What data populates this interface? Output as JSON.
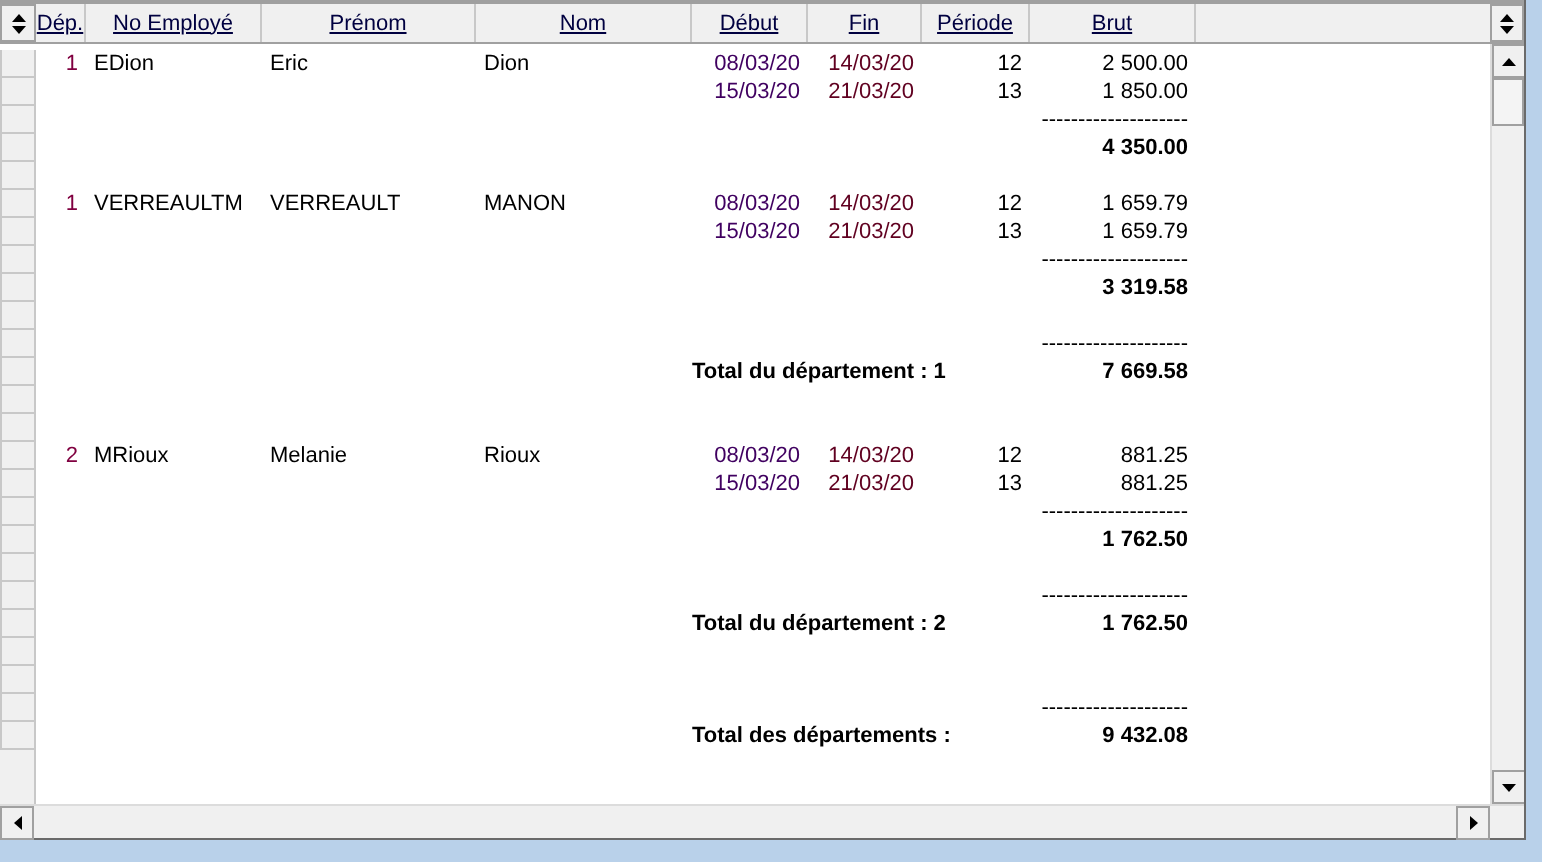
{
  "columns": [
    "Dép.",
    "No Employé",
    "Prénom",
    "Nom",
    "Début",
    "Fin",
    "Période",
    "Brut"
  ],
  "lines": [
    {
      "kind": "employee",
      "dep": "1",
      "employee_no": "EDion",
      "first_name": "Eric",
      "last_name": "Dion",
      "start": "08/03/20",
      "end": "14/03/20",
      "period": "12",
      "gross": "2 500.00"
    },
    {
      "kind": "period",
      "start": "15/03/20",
      "end": "21/03/20",
      "period": "13",
      "gross": "1 850.00"
    },
    {
      "kind": "dashes",
      "gross": "--------------------"
    },
    {
      "kind": "subtotal",
      "gross": "4 350.00"
    },
    {
      "kind": "blank"
    },
    {
      "kind": "employee",
      "dep": "1",
      "employee_no": "VERREAULTM",
      "first_name": "VERREAULT",
      "last_name": "MANON",
      "start": "08/03/20",
      "end": "14/03/20",
      "period": "12",
      "gross": "1 659.79"
    },
    {
      "kind": "period",
      "start": "15/03/20",
      "end": "21/03/20",
      "period": "13",
      "gross": "1 659.79"
    },
    {
      "kind": "dashes",
      "gross": "--------------------"
    },
    {
      "kind": "subtotal",
      "gross": "3 319.58"
    },
    {
      "kind": "blank"
    },
    {
      "kind": "dashes",
      "gross": "--------------------"
    },
    {
      "kind": "total",
      "label": "Total du département : 1",
      "gross": "7 669.58"
    },
    {
      "kind": "blank"
    },
    {
      "kind": "blank"
    },
    {
      "kind": "employee",
      "dep": "2",
      "employee_no": "MRioux",
      "first_name": "Melanie",
      "last_name": "Rioux",
      "start": "08/03/20",
      "end": "14/03/20",
      "period": "12",
      "gross": "881.25"
    },
    {
      "kind": "period",
      "start": "15/03/20",
      "end": "21/03/20",
      "period": "13",
      "gross": "881.25"
    },
    {
      "kind": "dashes",
      "gross": "--------------------"
    },
    {
      "kind": "subtotal",
      "gross": "1 762.50"
    },
    {
      "kind": "blank"
    },
    {
      "kind": "dashes",
      "gross": "--------------------"
    },
    {
      "kind": "total",
      "label": "Total du département : 2",
      "gross": "1 762.50"
    },
    {
      "kind": "blank"
    },
    {
      "kind": "blank"
    },
    {
      "kind": "dashes",
      "gross": "--------------------"
    },
    {
      "kind": "total",
      "label": "Total des départements :",
      "gross": "9 432.08"
    }
  ]
}
